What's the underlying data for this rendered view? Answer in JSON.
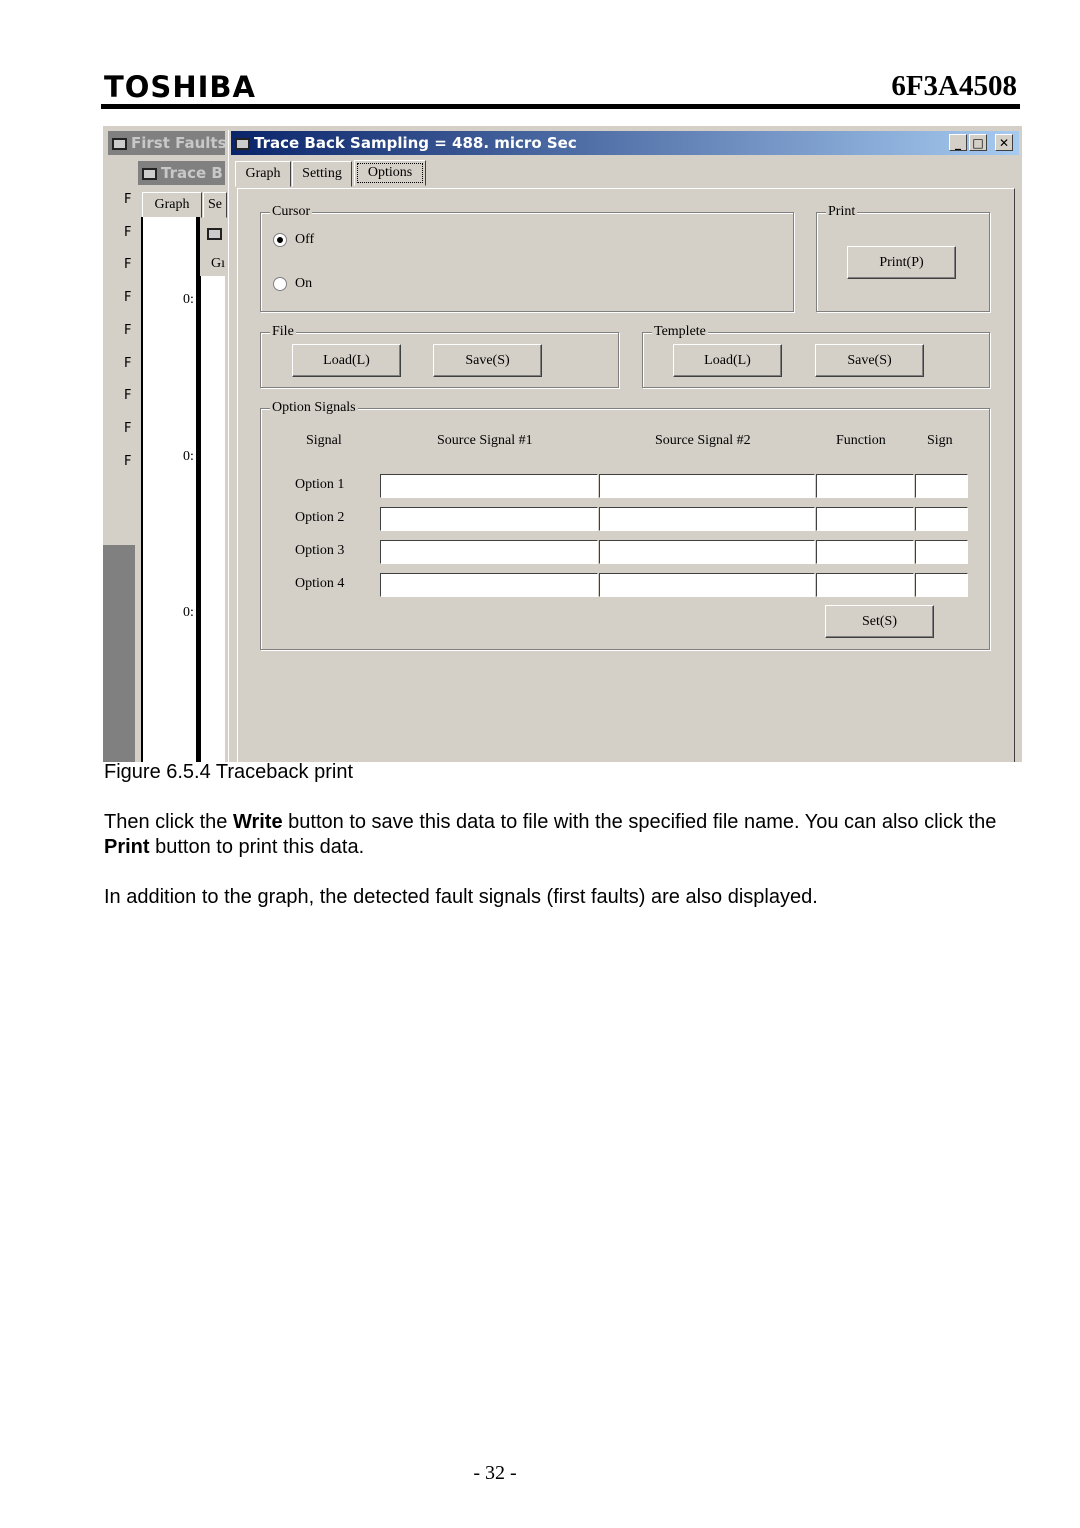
{
  "header": {
    "brand": "TOSHIBA",
    "doc_number": "6F3A4508"
  },
  "screenshot": {
    "back_window": {
      "title": "First Faults",
      "inner_title": "Trace B",
      "tabs": [
        "Graph",
        "Se"
      ],
      "inner_tab": "Gı",
      "fault_labels": [
        "F",
        "F",
        "F",
        "F",
        "F",
        "F",
        "F",
        "F",
        "F"
      ],
      "axis_labels": [
        "0:",
        "0:",
        "0:"
      ]
    },
    "window": {
      "title": "Trace Back Sampling = 488. micro Sec",
      "controls": {
        "minimize": "_",
        "maximize": "□",
        "close": "✕"
      },
      "tabs": [
        {
          "label": "Graph"
        },
        {
          "label": "Setting"
        },
        {
          "label": "Options",
          "selected": true
        }
      ],
      "cursor": {
        "label": "Cursor",
        "options": [
          {
            "label": "Off",
            "checked": true
          },
          {
            "label": "On",
            "checked": false
          }
        ]
      },
      "print": {
        "label": "Print",
        "button": "Print(P)"
      },
      "file": {
        "label": "File",
        "load": "Load(L)",
        "save": "Save(S)"
      },
      "template": {
        "label": "Templete",
        "load": "Load(L)",
        "save": "Save(S)"
      },
      "option_signals": {
        "label": "Option Signals",
        "columns": [
          "Signal",
          "Source Signal #1",
          "Source Signal #2",
          "Function",
          "Sign"
        ],
        "rows": [
          {
            "signal": "Option 1",
            "source1": "",
            "source2": "",
            "function": "",
            "sign": ""
          },
          {
            "signal": "Option 2",
            "source1": "",
            "source2": "",
            "function": "",
            "sign": ""
          },
          {
            "signal": "Option 3",
            "source1": "",
            "source2": "",
            "function": "",
            "sign": ""
          },
          {
            "signal": "Option 4",
            "source1": "",
            "source2": "",
            "function": "",
            "sign": ""
          }
        ],
        "set_button": "Set(S)"
      }
    }
  },
  "caption": "Figure 6.5.4 Traceback print",
  "paragraphs": {
    "p1_a": "Then click the ",
    "p1_b": "Write",
    "p1_c": " button to save this data to file with the specified file name. You can also click the ",
    "p1_d": "Print",
    "p1_e": " button to print this data.",
    "p2": "In addition to the graph, the detected fault signals (first faults) are also displayed."
  },
  "footer": {
    "page": "- 32 -"
  }
}
